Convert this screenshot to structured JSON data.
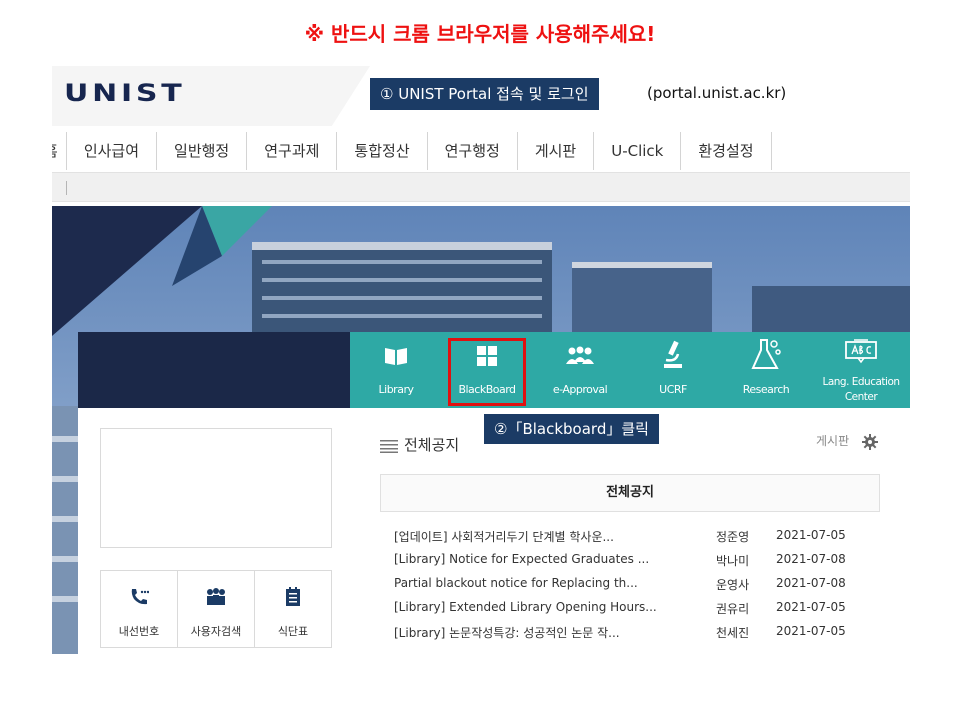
{
  "banner": "※ 반드시 크롬 브라우저를 사용해주세요!",
  "header": {
    "logo": "UNIST",
    "callout_step1": "① UNIST Portal 접속 및 로그인",
    "url_text": "(portal.unist.ac.kr)"
  },
  "nav": {
    "items": [
      "홈",
      "인사급여",
      "일반행정",
      "연구과제",
      "통합정산",
      "연구행정",
      "게시판",
      "U-Click",
      "환경설정"
    ]
  },
  "quicklinks": [
    {
      "label": "Library",
      "icon": "book-icon"
    },
    {
      "label": "BlackBoard",
      "icon": "grid-icon"
    },
    {
      "label": "e-Approval",
      "icon": "people-icon"
    },
    {
      "label": "UCRF",
      "icon": "microscope-icon"
    },
    {
      "label": "Research",
      "icon": "flask-icon"
    },
    {
      "label": "Lang. Education Center",
      "icon": "abc-board-icon"
    }
  ],
  "callout_step2": "②「Blackboard」클릭",
  "left_buttons": [
    {
      "label": "내선번호",
      "icon": "phone-icon"
    },
    {
      "label": "사용자검색",
      "icon": "users-icon"
    },
    {
      "label": "식단표",
      "icon": "menu-icon"
    }
  ],
  "notice": {
    "title": "전체공지",
    "board_link": "게시판",
    "table_header": "전체공지",
    "rows": [
      {
        "title": "[업데이트] 사회적거리두기 단계별 학사운...",
        "author": "정준영",
        "date": "2021-07-05"
      },
      {
        "title": "[Library] Notice for Expected Graduates ...",
        "author": "박나미",
        "date": "2021-07-08"
      },
      {
        "title": "Partial blackout notice for Replacing th...",
        "author": "운영사",
        "date": "2021-07-08"
      },
      {
        "title": "[Library] Extended Library Opening Hours...",
        "author": "권유리",
        "date": "2021-07-05"
      },
      {
        "title": "[Library] 논문작성특강: 성공적인 논문 작...",
        "author": "천세진",
        "date": "2021-07-05"
      }
    ]
  },
  "colors": {
    "banner_red": "#ee1111",
    "callout_navy": "#1b3b65",
    "quicklink_teal": "#2ea9a5",
    "dark_bar": "#1b2848",
    "highlight_red": "#e01010"
  }
}
